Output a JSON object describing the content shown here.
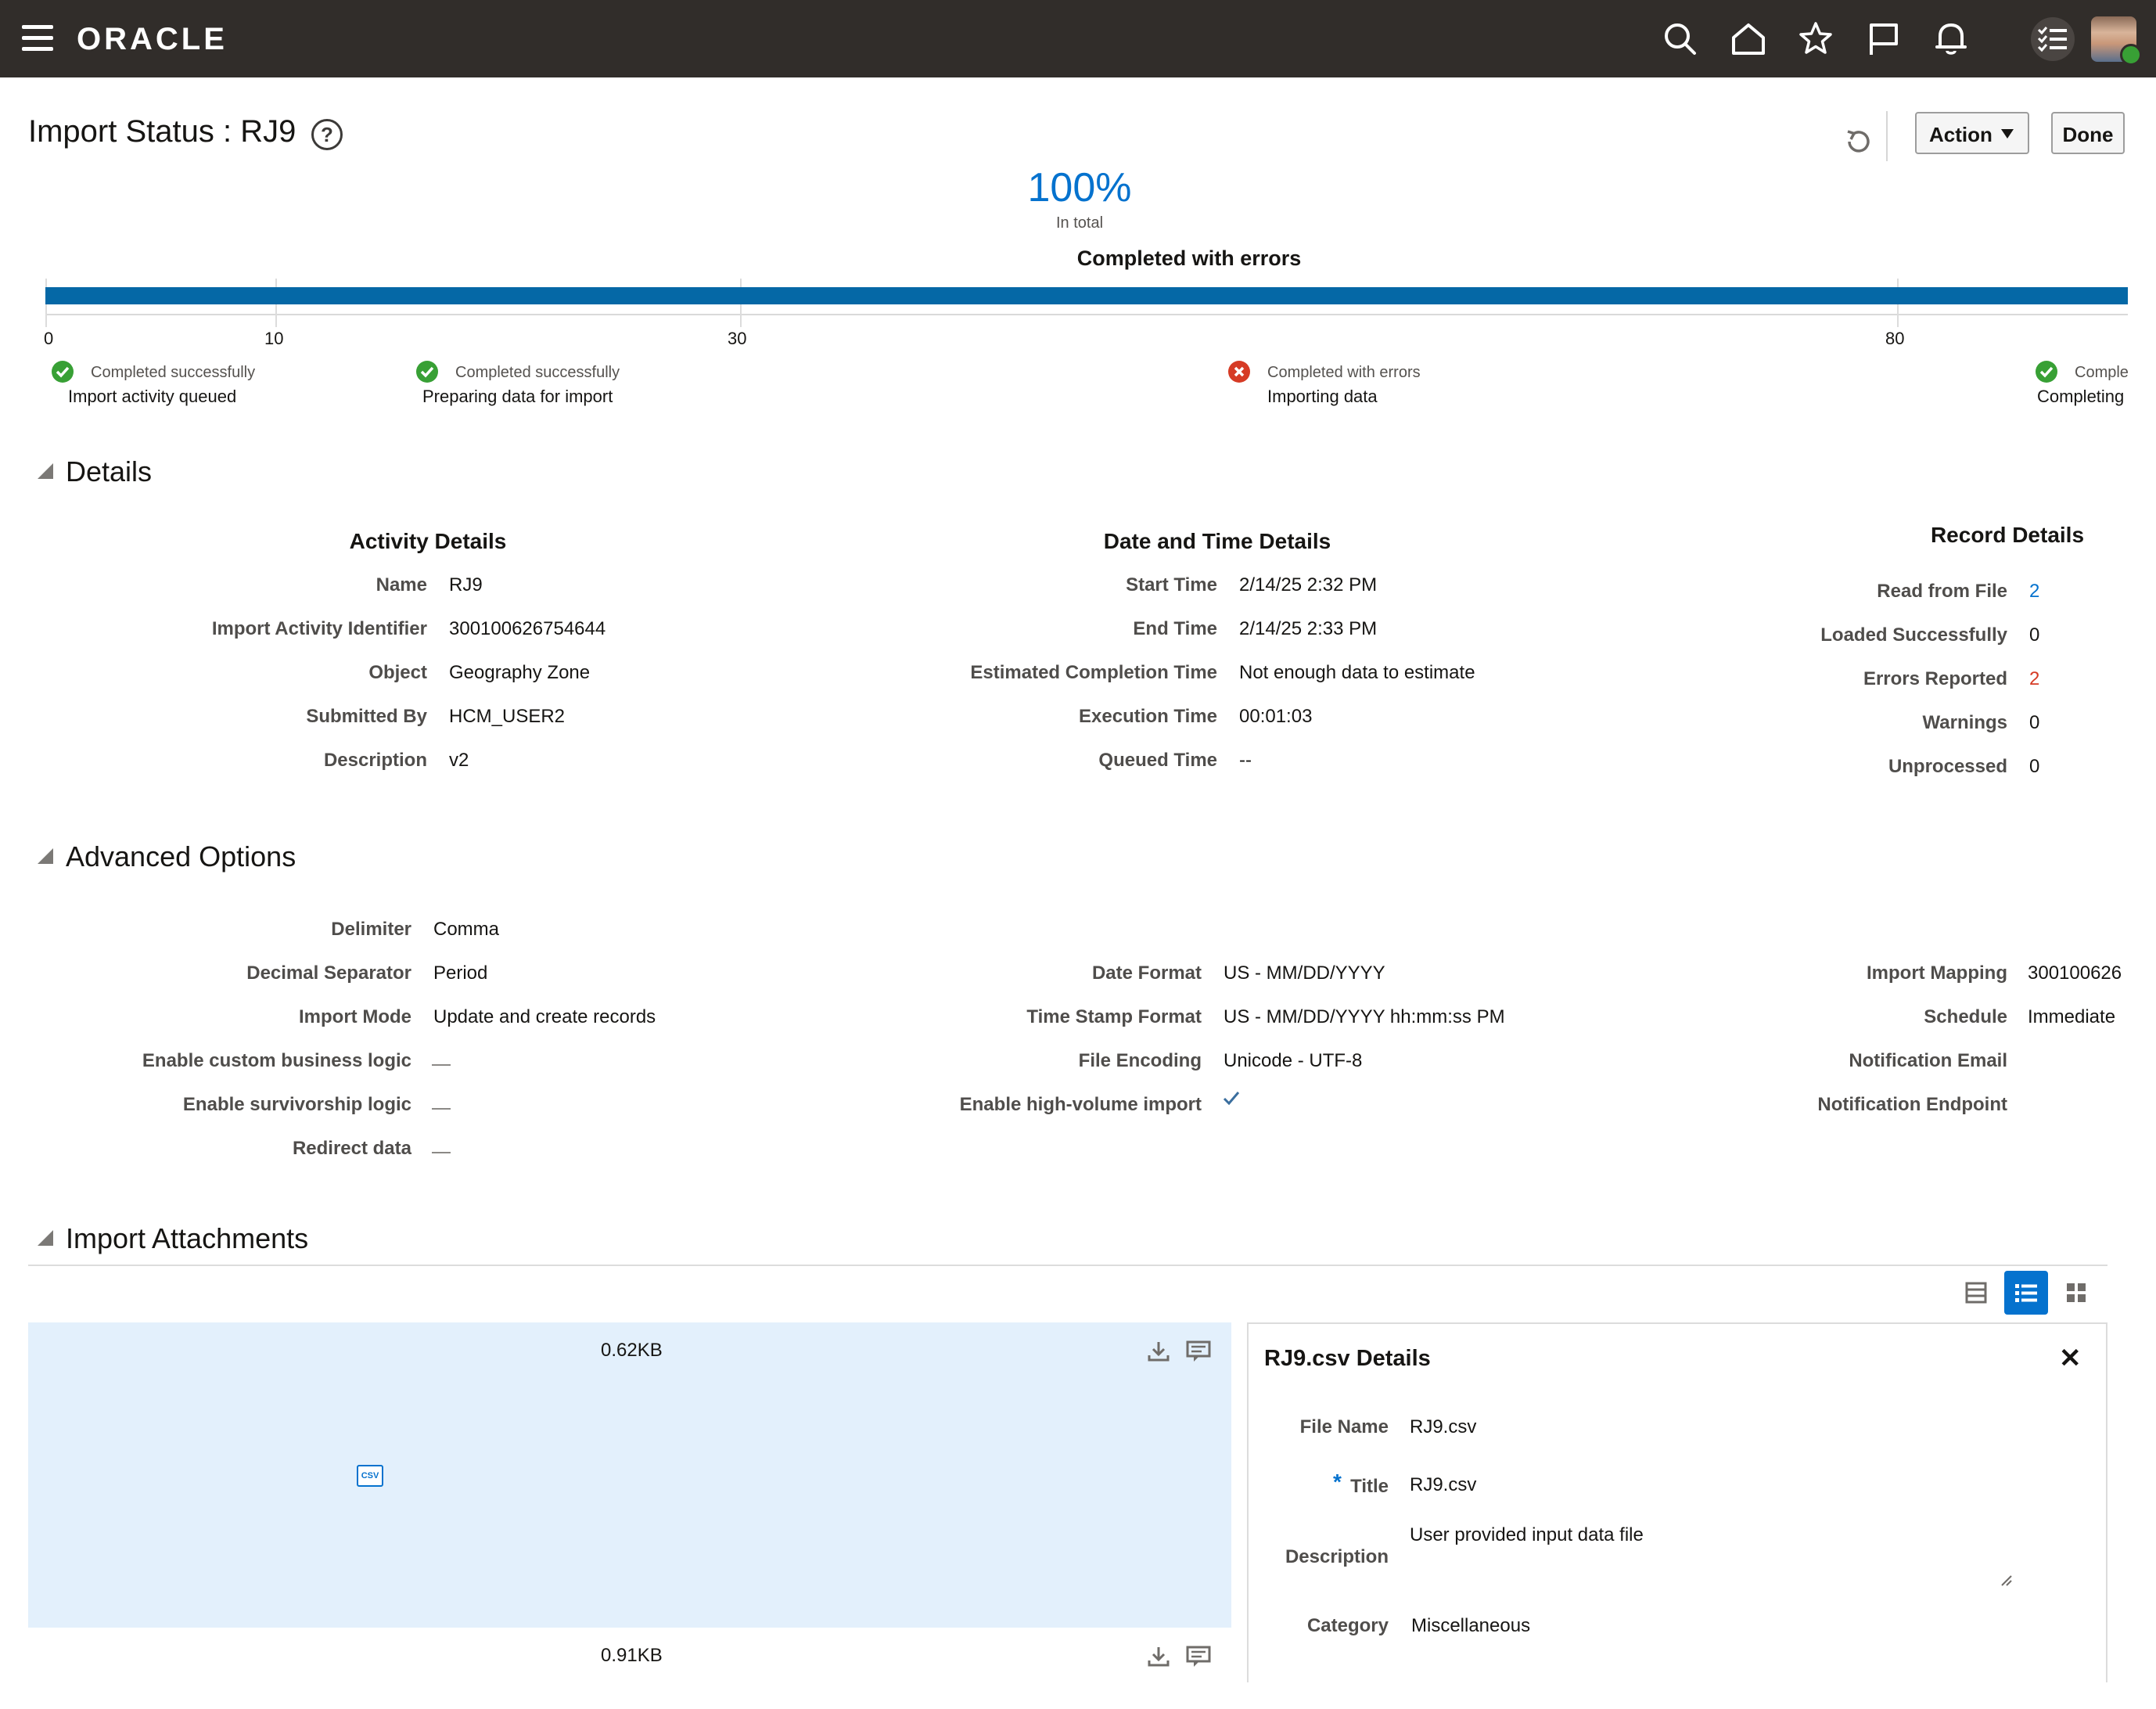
{
  "header": {
    "brand": "ORACLE",
    "icons": [
      "menu-icon",
      "search-icon",
      "home-icon",
      "favorites-icon",
      "flag-icon",
      "notifications-icon",
      "tasks-icon",
      "avatar"
    ]
  },
  "page": {
    "title": "Import Status : RJ9",
    "actions": {
      "action_label": "Action",
      "done_label": "Done"
    }
  },
  "progress": {
    "percent": "100%",
    "sub": "In total",
    "status": "Completed with errors",
    "fill_fraction": 1.0,
    "ticks": [
      "0",
      "10",
      "30",
      "80"
    ],
    "stages": [
      {
        "status": "Completed successfully",
        "name": "Import activity queued",
        "state": "ok"
      },
      {
        "status": "Completed successfully",
        "name": "Preparing data for import",
        "state": "ok"
      },
      {
        "status": "Completed with errors",
        "name": "Importing data",
        "state": "error"
      },
      {
        "status": "Comple",
        "name": "Completing",
        "state": "ok"
      }
    ]
  },
  "details": {
    "section_title": "Details",
    "activity": {
      "title": "Activity Details",
      "rows": [
        {
          "label": "Name",
          "value": "RJ9"
        },
        {
          "label": "Import Activity Identifier",
          "value": "300100626754644"
        },
        {
          "label": "Object",
          "value": "Geography Zone"
        },
        {
          "label": "Submitted By",
          "value": "HCM_USER2"
        },
        {
          "label": "Description",
          "value": "v2"
        }
      ]
    },
    "datetime": {
      "title": "Date and Time Details",
      "rows": [
        {
          "label": "Start Time",
          "value": "2/14/25 2:32 PM"
        },
        {
          "label": "End Time",
          "value": "2/14/25 2:33 PM"
        },
        {
          "label": "Estimated Completion Time",
          "value": "Not enough data to estimate"
        },
        {
          "label": "Execution Time",
          "value": "00:01:03"
        },
        {
          "label": "Queued Time",
          "value": "--"
        }
      ]
    },
    "records": {
      "title": "Record Details",
      "rows": [
        {
          "label": "Read from File",
          "value": "2",
          "color": "#0572ce"
        },
        {
          "label": "Loaded Successfully",
          "value": "0",
          "color": "#161513"
        },
        {
          "label": "Errors Reported",
          "value": "2",
          "color": "#d63b25"
        },
        {
          "label": "Warnings",
          "value": "0",
          "color": "#161513"
        },
        {
          "label": "Unprocessed",
          "value": "0",
          "color": "#161513"
        }
      ]
    }
  },
  "advanced": {
    "section_title": "Advanced Options",
    "col1": [
      {
        "label": "Delimiter",
        "value": "Comma"
      },
      {
        "label": "Decimal Separator",
        "value": "Period"
      },
      {
        "label": "Import Mode",
        "value": "Update and create records"
      },
      {
        "label": "Enable custom business logic",
        "value": ""
      },
      {
        "label": "Enable survivorship logic",
        "value": ""
      },
      {
        "label": "Redirect data",
        "value": ""
      }
    ],
    "col2": [
      {
        "label": "Date Format",
        "value": "US - MM/DD/YYYY"
      },
      {
        "label": "Time Stamp Format",
        "value": "US - MM/DD/YYYY hh:mm:ss PM"
      },
      {
        "label": "File Encoding",
        "value": "Unicode - UTF-8"
      },
      {
        "label": "Enable high-volume import",
        "value": ""
      }
    ],
    "col3": [
      {
        "label": "Import Mapping",
        "value": "300100626"
      },
      {
        "label": "Schedule",
        "value": "Immediate"
      },
      {
        "label": "Notification Email",
        "value": ""
      },
      {
        "label": "Notification Endpoint",
        "value": ""
      }
    ]
  },
  "attachments": {
    "section_title": "Import Attachments",
    "files": [
      {
        "size": "0.62KB"
      },
      {
        "size": "0.91KB"
      }
    ],
    "panel": {
      "title": "RJ9.csv Details",
      "file_name_label": "File Name",
      "file_name": "RJ9.csv",
      "required_mark": "*",
      "title_label": "Title",
      "title_value": "RJ9.csv",
      "description_label": "Description",
      "description_value": "User provided input data file",
      "category_label": "Category",
      "category_value": "Miscellaneous"
    }
  }
}
